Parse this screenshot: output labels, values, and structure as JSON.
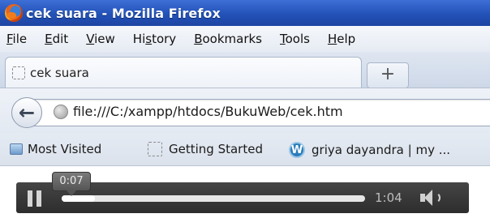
{
  "window": {
    "title": "cek suara - Mozilla Firefox"
  },
  "menu": {
    "items": [
      {
        "label": "File",
        "accel": "F"
      },
      {
        "label": "Edit",
        "accel": "E"
      },
      {
        "label": "View",
        "accel": "V"
      },
      {
        "label": "History",
        "accel": "s"
      },
      {
        "label": "Bookmarks",
        "accel": "B"
      },
      {
        "label": "Tools",
        "accel": "T"
      },
      {
        "label": "Help",
        "accel": "H"
      }
    ]
  },
  "tabs": [
    {
      "label": "cek suara",
      "icon": "blank-page-icon",
      "active": true
    }
  ],
  "new_tab": {
    "label": "+"
  },
  "navigation": {
    "back_icon": "back-arrow-icon",
    "url": "file:///C:/xampp/htdocs/BukuWeb/cek.htm"
  },
  "bookmarks": {
    "items": [
      {
        "label": "Most Visited",
        "icon": "most-visited-icon"
      },
      {
        "label": "Getting Started",
        "icon": "blank-page-icon"
      },
      {
        "label": "griya dayandra | my ...",
        "icon": "wordpress-icon"
      }
    ]
  },
  "audio_player": {
    "state": "playing",
    "current_time": "0:07",
    "duration": "1:04",
    "progress": 0.11
  },
  "colors": {
    "titlebar": "#2352b8",
    "player_bg": "#3a3a3a"
  }
}
